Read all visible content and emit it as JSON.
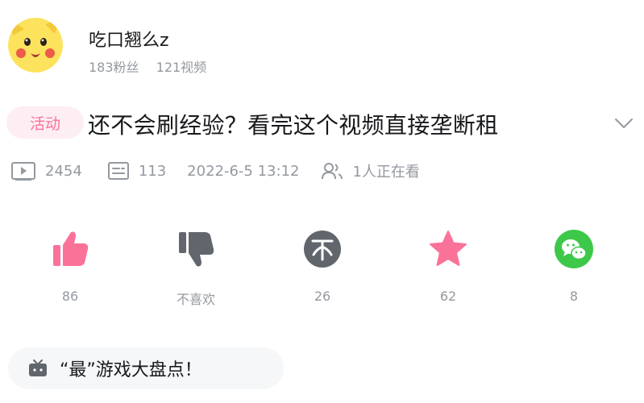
{
  "uploader": {
    "avatar_icon": "pikachu-avatar-icon",
    "name": "吃口翘么z",
    "fans": "183粉丝",
    "videos": "121视频"
  },
  "video": {
    "tag": "活动",
    "title": "还不会刷经验？看完这个视频直接垄断租",
    "expand_icon": "chevron-down-icon"
  },
  "meta": {
    "plays": "2454",
    "danmaku": "113",
    "date": "2022-6-5 13:12",
    "watching": "1人正在看"
  },
  "actions": [
    {
      "name": "like",
      "icon": "thumbs-up-icon",
      "label": "86",
      "color": "#fb7299"
    },
    {
      "name": "dislike",
      "icon": "thumbs-down-icon",
      "label": "不喜欢",
      "color": "#61666d"
    },
    {
      "name": "coin",
      "icon": "coin-icon",
      "label": "26",
      "color": "#61666d"
    },
    {
      "name": "favorite",
      "icon": "star-icon",
      "label": "62",
      "color": "#fb7299"
    },
    {
      "name": "share-wechat",
      "icon": "wechat-icon",
      "label": "8",
      "color": "#3dc84a"
    }
  ],
  "topic": {
    "icon": "tv-icon",
    "text": "“最”游戏大盘点！"
  },
  "colors": {
    "accent_pink": "#fb7299",
    "tag_bg": "#fdeef3",
    "secondary_text": "#9499a0",
    "wechat_green": "#3dc84a"
  }
}
